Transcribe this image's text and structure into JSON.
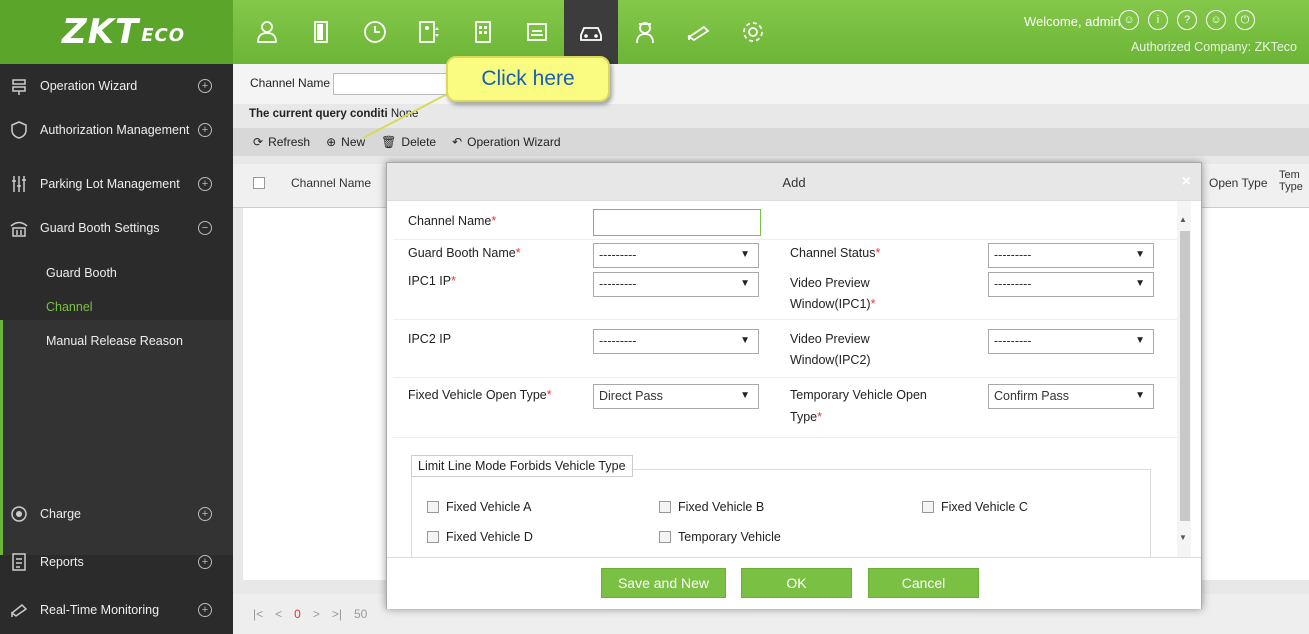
{
  "header": {
    "logo_text": "ZKTeco",
    "nav_icons": [
      "person-icon",
      "door-icon",
      "clock-icon",
      "elevator-icon",
      "building-icon",
      "vehicle-card-icon",
      "car-icon",
      "guard-icon",
      "camera-icon",
      "gear-icon"
    ],
    "welcome": "Welcome, admin",
    "company": "Authorized Company: ZKTeco",
    "brand_color": "#7ac143"
  },
  "sidebar": {
    "items": [
      {
        "label": "Operation Wizard"
      },
      {
        "label": "Authorization Management"
      },
      {
        "label": "Parking Lot Management"
      },
      {
        "label": "Guard Booth Settings"
      },
      {
        "label": "Charge"
      },
      {
        "label": "Reports"
      },
      {
        "label": "Real-Time Monitoring"
      }
    ],
    "sub_items": [
      {
        "label": "Guard Booth"
      },
      {
        "label": "Channel"
      },
      {
        "label": "Manual Release Reason"
      }
    ]
  },
  "filter": {
    "label": "Channel Name",
    "condition_label": "The current query conditi",
    "condition_value": "None"
  },
  "toolbar": {
    "refresh": "Refresh",
    "new": "New",
    "delete": "Delete",
    "wizard": "Operation Wizard"
  },
  "table": {
    "col_channel": "Channel Name",
    "col_open_type": "Open Type",
    "col_temp": "Tem Type"
  },
  "pager": {
    "page": "0",
    "size": "50"
  },
  "callout": {
    "text": "Click here"
  },
  "modal": {
    "title": "Add",
    "channel_name_label": "Channel Name",
    "guard_booth_label": "Guard Booth Name",
    "guard_booth_value": "---------",
    "channel_status_label": "Channel Status",
    "channel_status_value": "---------",
    "ipc1_label": "IPC1 IP",
    "ipc1_value": "---------",
    "vp1_label_a": "Video Preview",
    "vp1_label_b": "Window(IPC1)",
    "vp1_value": "---------",
    "ipc2_label": "IPC2 IP",
    "ipc2_value": "---------",
    "vp2_label_a": "Video Preview",
    "vp2_label_b": "Window(IPC2)",
    "vp2_value": "---------",
    "fixed_open_label": "Fixed Vehicle Open Type",
    "fixed_open_value": "Direct Pass",
    "temp_open_label_a": "Temporary Vehicle Open",
    "temp_open_label_b": "Type",
    "temp_open_value": "Confirm Pass",
    "limit_legend": "Limit Line Mode Forbids Vehicle Type",
    "vehicles": [
      "Fixed Vehicle A",
      "Fixed Vehicle B",
      "Fixed Vehicle C",
      "Fixed Vehicle D",
      "Temporary Vehicle"
    ],
    "btn_save_new": "Save and New",
    "btn_ok": "OK",
    "btn_cancel": "Cancel"
  }
}
